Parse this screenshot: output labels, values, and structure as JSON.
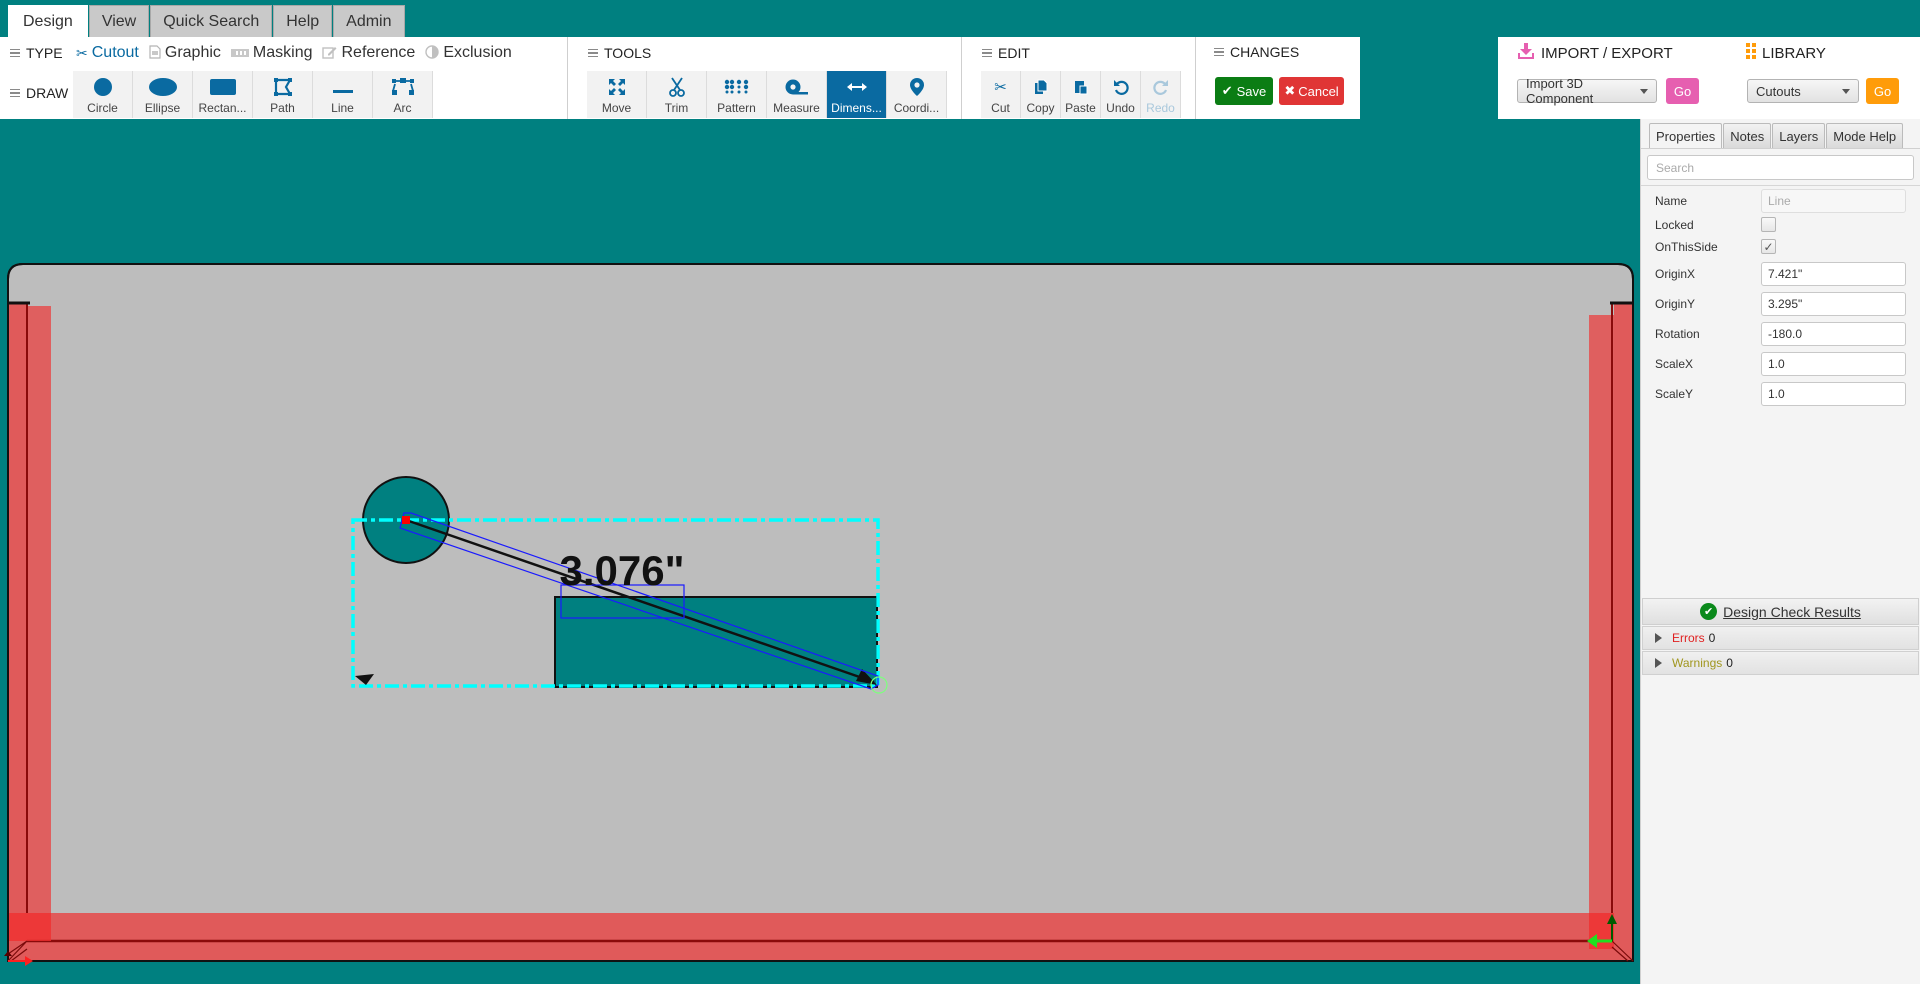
{
  "top_tabs": [
    {
      "label": "Design",
      "active": true
    },
    {
      "label": "View",
      "active": false
    },
    {
      "label": "Quick Search",
      "active": false
    },
    {
      "label": "Help",
      "active": false
    },
    {
      "label": "Admin",
      "active": false
    }
  ],
  "ribbon": {
    "type": {
      "title": "TYPE",
      "items": [
        {
          "label": "Cutout",
          "icon": "scissors-icon",
          "active": true
        },
        {
          "label": "Graphic",
          "icon": "image-file-icon",
          "active": false
        },
        {
          "label": "Masking",
          "icon": "masking-icon",
          "active": false
        },
        {
          "label": "Reference",
          "icon": "edit-icon",
          "active": false
        },
        {
          "label": "Exclusion",
          "icon": "half-circle-icon",
          "active": false
        }
      ]
    },
    "draw": {
      "title": "DRAW",
      "items": [
        {
          "label": "Circle",
          "icon": "circle-icon"
        },
        {
          "label": "Ellipse",
          "icon": "ellipse-icon"
        },
        {
          "label": "Rectan...",
          "icon": "rectangle-icon"
        },
        {
          "label": "Path",
          "icon": "path-icon"
        },
        {
          "label": "Line",
          "icon": "line-icon"
        },
        {
          "label": "Arc",
          "icon": "arc-icon"
        }
      ]
    },
    "tools": {
      "title": "TOOLS",
      "items": [
        {
          "label": "Move",
          "icon": "move-icon",
          "active": false
        },
        {
          "label": "Trim",
          "icon": "scissors-icon",
          "active": false
        },
        {
          "label": "Pattern",
          "icon": "pattern-icon",
          "active": false
        },
        {
          "label": "Measure",
          "icon": "tape-measure-icon",
          "active": false
        },
        {
          "label": "Dimens...",
          "icon": "dimension-arrows-icon",
          "active": true
        },
        {
          "label": "Coordi...",
          "icon": "map-pin-icon",
          "active": false
        }
      ]
    },
    "edit": {
      "title": "EDIT",
      "items": [
        {
          "label": "Cut",
          "icon": "scissors-icon",
          "disabled": false
        },
        {
          "label": "Copy",
          "icon": "copy-icon",
          "disabled": false
        },
        {
          "label": "Paste",
          "icon": "paste-icon",
          "disabled": false
        },
        {
          "label": "Undo",
          "icon": "undo-icon",
          "disabled": false
        },
        {
          "label": "Redo",
          "icon": "redo-icon",
          "disabled": true
        }
      ]
    },
    "changes": {
      "title": "CHANGES",
      "save_label": "Save",
      "cancel_label": "Cancel"
    },
    "import_export": {
      "title": "IMPORT / EXPORT",
      "selected": "Import 3D Component",
      "go_label": "Go",
      "color": "#e65fb0"
    },
    "library": {
      "title": "LIBRARY",
      "selected": "Cutouts",
      "go_label": "Go",
      "color": "#ff9c0a"
    }
  },
  "canvas": {
    "dimension_label": "3.076\"",
    "colors": {
      "background": "#bdbdbd",
      "shape_fill": "#008080",
      "selection": "#00ffff",
      "keepout": "#e05050"
    }
  },
  "panel": {
    "tabs": [
      {
        "label": "Properties",
        "active": true
      },
      {
        "label": "Notes",
        "active": false
      },
      {
        "label": "Layers",
        "active": false
      },
      {
        "label": "Mode Help",
        "active": false
      }
    ],
    "search_placeholder": "Search",
    "properties": {
      "name": {
        "label": "Name",
        "value": "Line"
      },
      "locked": {
        "label": "Locked",
        "checked": false
      },
      "on_this_side": {
        "label": "OnThisSide",
        "checked": true
      },
      "origin_x": {
        "label": "OriginX",
        "value": "7.421\""
      },
      "origin_y": {
        "label": "OriginY",
        "value": "3.295\""
      },
      "rotation": {
        "label": "Rotation",
        "value": "-180.0"
      },
      "scale_x": {
        "label": "ScaleX",
        "value": "1.0"
      },
      "scale_y": {
        "label": "ScaleY",
        "value": "1.0"
      }
    },
    "design_check": {
      "title": "Design Check Results",
      "errors_label": "Errors",
      "errors_count": "0",
      "warnings_label": "Warnings",
      "warnings_count": "0"
    }
  }
}
